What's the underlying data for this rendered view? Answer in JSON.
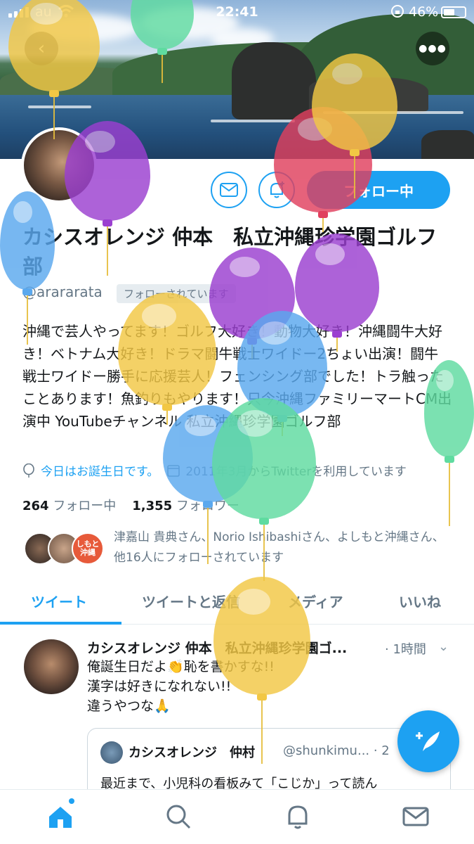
{
  "status_bar": {
    "carrier": "au",
    "time": "22:41",
    "battery_pct": "46%"
  },
  "header": {
    "back_icon": "chevron-left-icon",
    "more_icon": "more-dots-icon"
  },
  "profile": {
    "name": "カシスオレンジ 仲本　私立沖縄珍学園ゴルフ部",
    "handle": "@arararata",
    "follows_you": "フォローされています",
    "follow_label": "フォロー中",
    "bio": "沖縄で芸人やってます！ゴルフ大好き！動物大好き！沖縄闘牛大好き！ベトナム大好き！ドラマ闘牛戦士ワイドー2ちょい出演！闘牛戦士ワイドー勝手に応援芸人！フェンシング部でした！トラ触ったことあります！魚釣りもやります！只今沖縄ファミリーマートCM出演中 YouTubeチャンネル 私立沖縄珍学園ゴルフ部",
    "birthday_text": "今日はお誕生日です。",
    "joined_text": "2011年3月からTwitterを利用しています",
    "following_count": "264",
    "following_label": "フォロー中",
    "followers_count": "1,355",
    "followers_label": "フォロワー",
    "followed_by": "津嘉山 貴典さん、Norio Ishibashiさん、よしもと沖縄さん、他16人にフォローされています",
    "followed_by_badge": "しもと沖縄"
  },
  "tabs": [
    {
      "label": "ツイート"
    },
    {
      "label": "ツイートと返信"
    },
    {
      "label": "メディア"
    },
    {
      "label": "いいね"
    }
  ],
  "tweet": {
    "name": "カシスオレンジ 仲本　私立沖縄珍学園ゴ...",
    "time": "· 1時間",
    "lines": [
      "俺誕生日だよ👏恥を書かすな!!",
      "漢字は好きになれない!!",
      "違うやつな🙏"
    ],
    "quote": {
      "name": "カシスオレンジ　仲村",
      "handle": "@shunkimu... · 2",
      "text": "最近まで、小児科の看板みて「こじか」って読ん"
    }
  },
  "fab_icon": "compose-feather-icon",
  "bottom_nav": [
    "home-icon",
    "search-icon",
    "notifications-icon",
    "messages-icon"
  ],
  "colors": {
    "accent": "#1da1f2",
    "text": "#14171a",
    "muted": "#657786"
  },
  "balloon_colors": {
    "yellow": "#f2c744",
    "purple": "#9b3fd0",
    "blue": "#5aa8ee",
    "green": "#5fdba0",
    "red": "#e0405e"
  }
}
